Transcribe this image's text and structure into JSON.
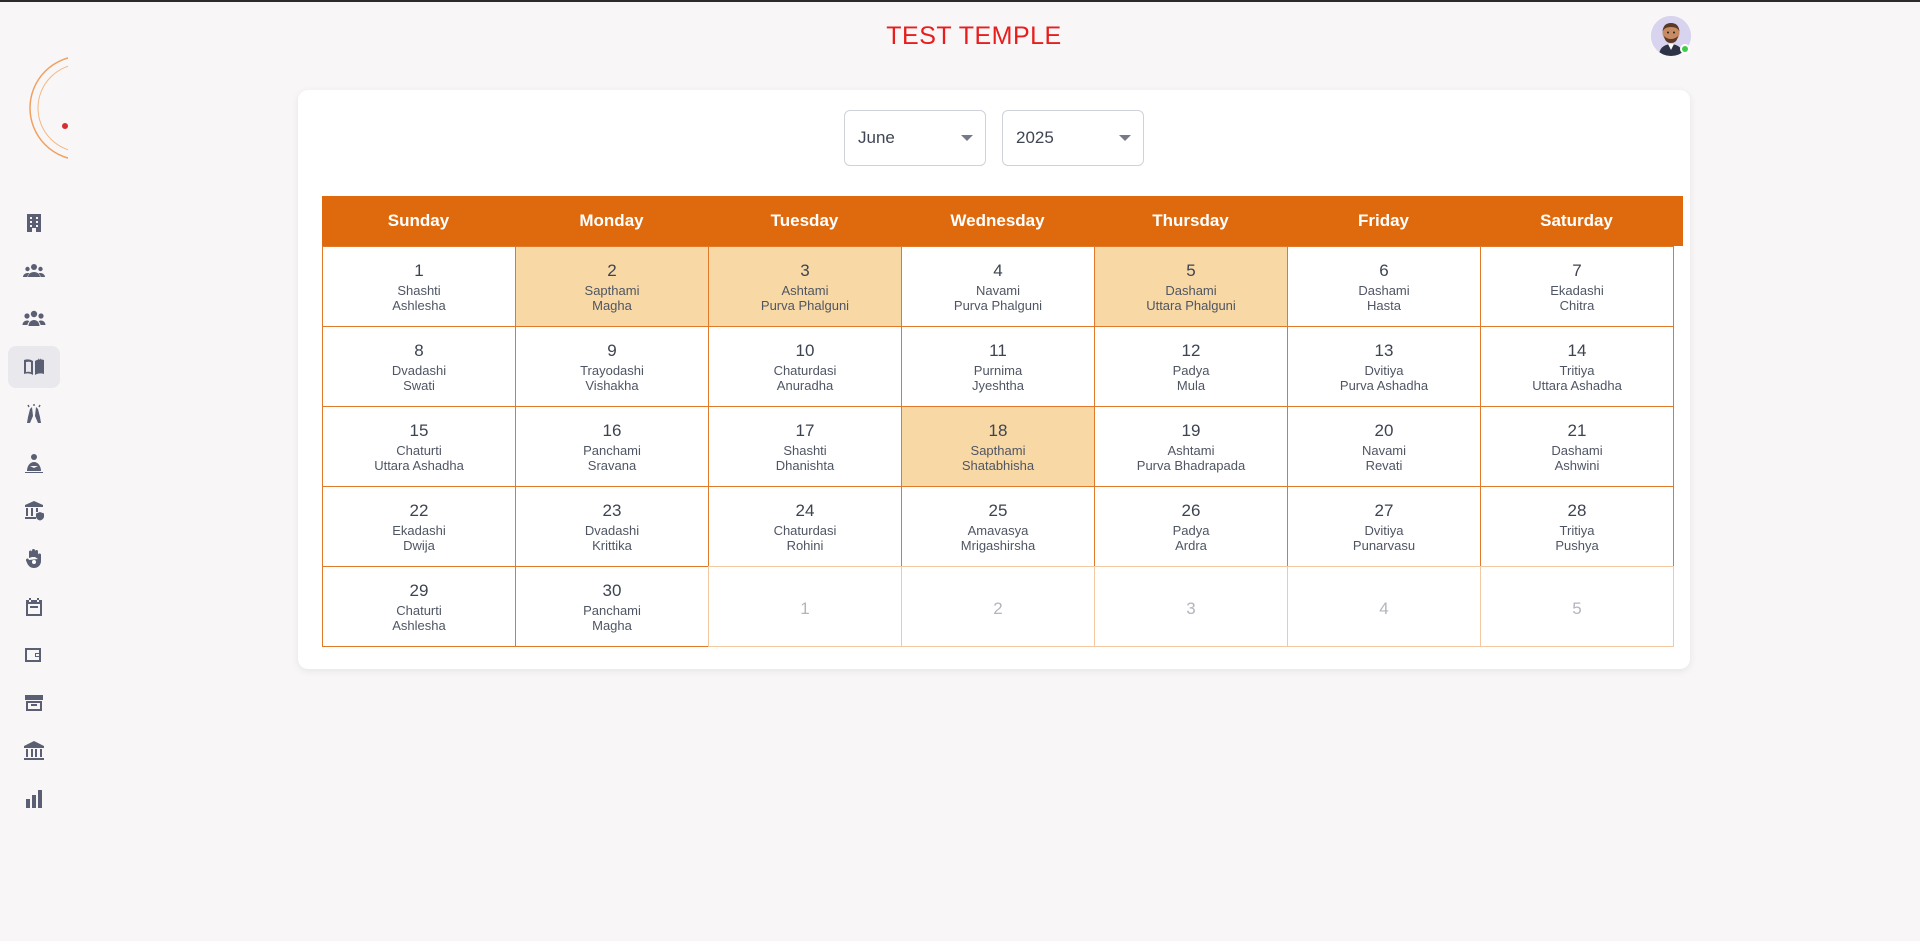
{
  "header": {
    "title": "TEST TEMPLE"
  },
  "sidebar": {
    "items": [
      {
        "icon": "building-icon",
        "active": false
      },
      {
        "icon": "users-icon",
        "active": false
      },
      {
        "icon": "groups-icon",
        "active": false
      },
      {
        "icon": "book-icon",
        "active": true
      },
      {
        "icon": "namaste-icon",
        "active": false
      },
      {
        "icon": "devotee-icon",
        "active": false
      },
      {
        "icon": "temple-shield-icon",
        "active": false
      },
      {
        "icon": "hand-icon",
        "active": false
      },
      {
        "icon": "calendar-icon",
        "active": false
      },
      {
        "icon": "wallet-icon",
        "active": false
      },
      {
        "icon": "archive-icon",
        "active": false
      },
      {
        "icon": "bank-icon",
        "active": false
      },
      {
        "icon": "bar-chart-icon",
        "active": false
      }
    ]
  },
  "filters": {
    "month": "June",
    "year": "2025"
  },
  "calendar": {
    "weekdays": [
      "Sunday",
      "Monday",
      "Tuesday",
      "Wednesday",
      "Thursday",
      "Friday",
      "Saturday"
    ],
    "days": [
      {
        "day": "1",
        "tithi": "Shashti",
        "nakshatra": "Ashlesha",
        "hl": false
      },
      {
        "day": "2",
        "tithi": "Sapthami",
        "nakshatra": "Magha",
        "hl": true
      },
      {
        "day": "3",
        "tithi": "Ashtami",
        "nakshatra": "Purva Phalguni",
        "hl": true
      },
      {
        "day": "4",
        "tithi": "Navami",
        "nakshatra": "Purva Phalguni",
        "hl": false
      },
      {
        "day": "5",
        "tithi": "Dashami",
        "nakshatra": "Uttara Phalguni",
        "hl": true
      },
      {
        "day": "6",
        "tithi": "Dashami",
        "nakshatra": "Hasta",
        "hl": false
      },
      {
        "day": "7",
        "tithi": "Ekadashi",
        "nakshatra": "Chitra",
        "hl": false
      },
      {
        "day": "8",
        "tithi": "Dvadashi",
        "nakshatra": "Swati",
        "hl": false
      },
      {
        "day": "9",
        "tithi": "Trayodashi",
        "nakshatra": "Vishakha",
        "hl": false
      },
      {
        "day": "10",
        "tithi": "Chaturdasi",
        "nakshatra": "Anuradha",
        "hl": false
      },
      {
        "day": "11",
        "tithi": "Purnima",
        "nakshatra": "Jyeshtha",
        "hl": false
      },
      {
        "day": "12",
        "tithi": "Padya",
        "nakshatra": "Mula",
        "hl": false
      },
      {
        "day": "13",
        "tithi": "Dvitiya",
        "nakshatra": "Purva Ashadha",
        "hl": false
      },
      {
        "day": "14",
        "tithi": "Tritiya",
        "nakshatra": "Uttara Ashadha",
        "hl": false
      },
      {
        "day": "15",
        "tithi": "Chaturti",
        "nakshatra": "Uttara Ashadha",
        "hl": false
      },
      {
        "day": "16",
        "tithi": "Panchami",
        "nakshatra": "Sravana",
        "hl": false
      },
      {
        "day": "17",
        "tithi": "Shashti",
        "nakshatra": "Dhanishta",
        "hl": false
      },
      {
        "day": "18",
        "tithi": "Sapthami",
        "nakshatra": "Shatabhisha",
        "hl": true
      },
      {
        "day": "19",
        "tithi": "Ashtami",
        "nakshatra": "Purva Bhadrapada",
        "hl": false
      },
      {
        "day": "20",
        "tithi": "Navami",
        "nakshatra": "Revati",
        "hl": false
      },
      {
        "day": "21",
        "tithi": "Dashami",
        "nakshatra": "Ashwini",
        "hl": false
      },
      {
        "day": "22",
        "tithi": "Ekadashi",
        "nakshatra": "Dwija",
        "hl": false
      },
      {
        "day": "23",
        "tithi": "Dvadashi",
        "nakshatra": "Krittika",
        "hl": false
      },
      {
        "day": "24",
        "tithi": "Chaturdasi",
        "nakshatra": "Rohini",
        "hl": false
      },
      {
        "day": "25",
        "tithi": "Amavasya",
        "nakshatra": "Mrigashirsha",
        "hl": false
      },
      {
        "day": "26",
        "tithi": "Padya",
        "nakshatra": "Ardra",
        "hl": false
      },
      {
        "day": "27",
        "tithi": "Dvitiya",
        "nakshatra": "Punarvasu",
        "hl": false
      },
      {
        "day": "28",
        "tithi": "Tritiya",
        "nakshatra": "Pushya",
        "hl": false
      },
      {
        "day": "29",
        "tithi": "Chaturti",
        "nakshatra": "Ashlesha",
        "hl": false
      },
      {
        "day": "30",
        "tithi": "Panchami",
        "nakshatra": "Magha",
        "hl": false
      }
    ],
    "next_month_days": [
      "1",
      "2",
      "3",
      "4",
      "5"
    ]
  },
  "colors": {
    "header_bg": "#de6a0d",
    "highlight": "#f8d9a6",
    "title": "#e81d1d",
    "border": "#e07a2a"
  }
}
